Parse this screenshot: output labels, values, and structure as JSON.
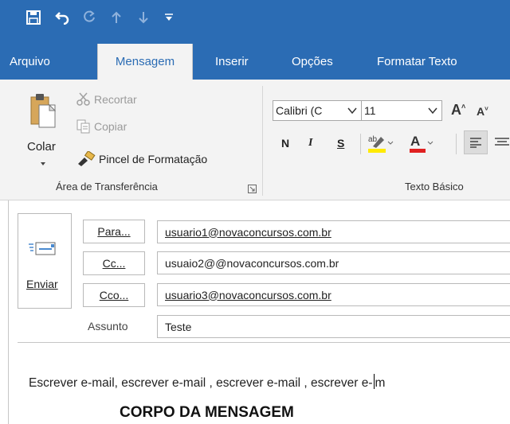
{
  "qat": {
    "save_icon": "save-icon",
    "undo_icon": "undo-icon",
    "redo_icon": "redo-icon",
    "up_icon": "arrow-up-icon",
    "down_icon": "arrow-down-icon",
    "customize_icon": "customize-qat-icon"
  },
  "tabs": [
    {
      "label": "Arquivo"
    },
    {
      "label": "Mensagem",
      "active": true
    },
    {
      "label": "Inserir"
    },
    {
      "label": "Opções"
    },
    {
      "label": "Formatar Texto"
    }
  ],
  "clipboard": {
    "paste_label": "Colar",
    "cut_label": "Recortar",
    "copy_label": "Copiar",
    "format_painter_label": "Pincel de Formatação",
    "group_label": "Área de Transferência"
  },
  "basic_text": {
    "font_name": "Calibri (C",
    "font_size": "11",
    "bold": "N",
    "italic": "I",
    "underline": "S",
    "group_label": "Texto Básico"
  },
  "compose": {
    "send_label": "Enviar",
    "to_label": "Para...",
    "cc_label": "Cc...",
    "bcc_label": "Cco...",
    "subject_label": "Assunto",
    "to_value": "usuario1@novaconcursos.com.br",
    "cc_value": "usuaio2@@novaconcursos.com.br",
    "bcc_value": "usuario3@novaconcursos.com.br",
    "subject_value": "Teste",
    "body_text_before_caret": "Escrever e-mail, escrever e-mail , escrever e-mail , escrever e-",
    "body_text_after_caret": "m",
    "body_heading": "CORPO DA MENSAGEM"
  },
  "colors": {
    "accent": "#2b6cb4",
    "ribbon_bg": "#f3f3f3",
    "highlight_yellow": "#ffea00",
    "font_color_red": "#e02020"
  }
}
